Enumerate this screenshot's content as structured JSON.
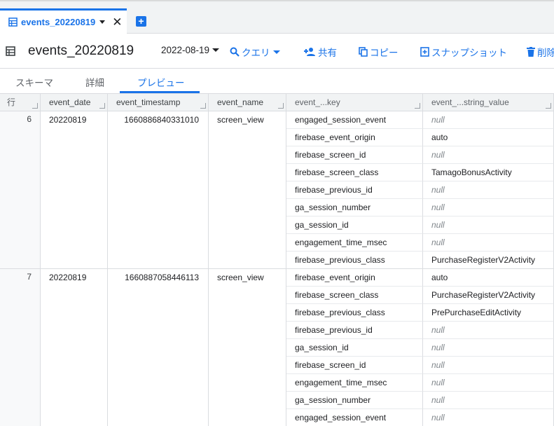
{
  "tab": {
    "label": "events_20220819",
    "close": "✕"
  },
  "toolbar": {
    "title": "events_20220819",
    "date": "2022-08-19",
    "query": "クエリ",
    "share": "共有",
    "copy": "コピー",
    "snapshot": "スナップショット",
    "delete": "削除"
  },
  "subtabs": [
    "スキーマ",
    "詳細",
    "プレビュー"
  ],
  "columns": [
    "行",
    "event_date",
    "event_timestamp",
    "event_name",
    "event_...key",
    "event_...string_value"
  ],
  "rows": [
    {
      "row": "6",
      "event_date": "20220819",
      "event_timestamp": "1660886840331010",
      "event_name": "screen_view",
      "params": [
        {
          "key": "engaged_session_event",
          "value": "null"
        },
        {
          "key": "firebase_event_origin",
          "value": "auto"
        },
        {
          "key": "firebase_screen_id",
          "value": "null"
        },
        {
          "key": "firebase_screen_class",
          "value": "TamagoBonusActivity"
        },
        {
          "key": "firebase_previous_id",
          "value": "null"
        },
        {
          "key": "ga_session_number",
          "value": "null"
        },
        {
          "key": "ga_session_id",
          "value": "null"
        },
        {
          "key": "engagement_time_msec",
          "value": "null"
        },
        {
          "key": "firebase_previous_class",
          "value": "PurchaseRegisterV2Activity"
        }
      ]
    },
    {
      "row": "7",
      "event_date": "20220819",
      "event_timestamp": "1660887058446113",
      "event_name": "screen_view",
      "params": [
        {
          "key": "firebase_event_origin",
          "value": "auto"
        },
        {
          "key": "firebase_screen_class",
          "value": "PurchaseRegisterV2Activity"
        },
        {
          "key": "firebase_previous_class",
          "value": "PrePurchaseEditActivity"
        },
        {
          "key": "firebase_previous_id",
          "value": "null"
        },
        {
          "key": "ga_session_id",
          "value": "null"
        },
        {
          "key": "firebase_screen_id",
          "value": "null"
        },
        {
          "key": "engagement_time_msec",
          "value": "null"
        },
        {
          "key": "ga_session_number",
          "value": "null"
        },
        {
          "key": "engaged_session_event",
          "value": "null"
        }
      ]
    }
  ],
  "colors": {
    "accent": "#1a73e8",
    "null_text": "#80868b"
  }
}
